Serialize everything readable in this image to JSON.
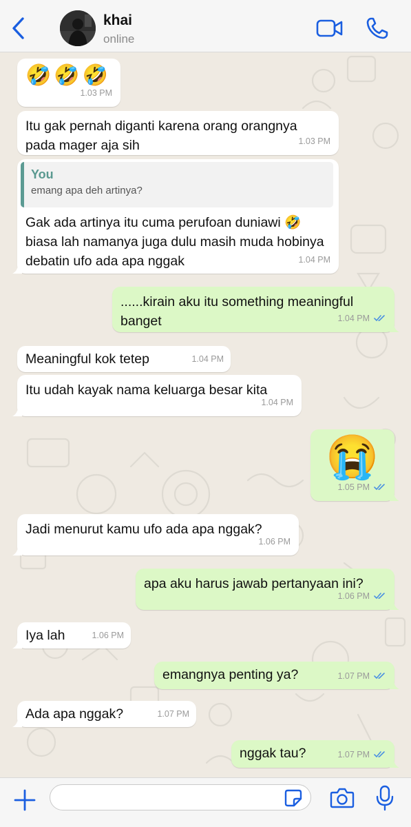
{
  "header": {
    "contact_name": "khai",
    "status": "online",
    "icons": {
      "back": "chevron-left-icon",
      "video": "video-camera-icon",
      "call": "phone-icon"
    }
  },
  "colors": {
    "accent": "#1a5ee0",
    "incoming_bubble": "#ffffff",
    "outgoing_bubble": "#dcf8c6",
    "chat_background": "#efeae2",
    "read_ticks": "#4a90e2",
    "reply_bar": "#5c9b93"
  },
  "messages": [
    {
      "dir": "in",
      "text": "🤣🤣🤣",
      "time": "1.03 PM"
    },
    {
      "dir": "in",
      "text": "Itu gak pernah diganti karena orang orangnya pada mager aja sih",
      "time": "1.03 PM"
    },
    {
      "dir": "in",
      "reply_author": "You",
      "reply_text": "emang apa deh artinya?",
      "text": "Gak ada artinya itu cuma perufoan duniawi 🤣 biasa lah namanya juga dulu masih muda hobinya debatin ufo ada apa nggak",
      "time": "1.04 PM"
    },
    {
      "dir": "out",
      "text": "......kirain aku itu something meaningful banget",
      "time": "1.04 PM"
    },
    {
      "dir": "in",
      "text": "Meaningful kok tetep",
      "time": "1.04 PM"
    },
    {
      "dir": "in",
      "text": "Itu udah kayak nama keluarga besar kita",
      "time": "1.04 PM"
    },
    {
      "dir": "out",
      "text": "😭",
      "time": "1.05 PM"
    },
    {
      "dir": "in",
      "text": "Jadi menurut kamu ufo ada apa nggak?",
      "time": "1.06 PM"
    },
    {
      "dir": "out",
      "text": "apa aku harus jawab pertanyaan ini?",
      "time": "1.06 PM"
    },
    {
      "dir": "in",
      "text": "Iya lah",
      "time": "1.06 PM"
    },
    {
      "dir": "out",
      "text": "emangnya penting ya?",
      "time": "1.07 PM"
    },
    {
      "dir": "in",
      "text": "Ada apa nggak?",
      "time": "1.07 PM"
    },
    {
      "dir": "out",
      "text": "nggak tau?",
      "time": "1.07 PM"
    }
  ],
  "composer": {
    "value": "",
    "icons": {
      "add": "plus-icon",
      "sticker": "sticker-icon",
      "camera": "camera-icon",
      "mic": "microphone-icon"
    }
  }
}
